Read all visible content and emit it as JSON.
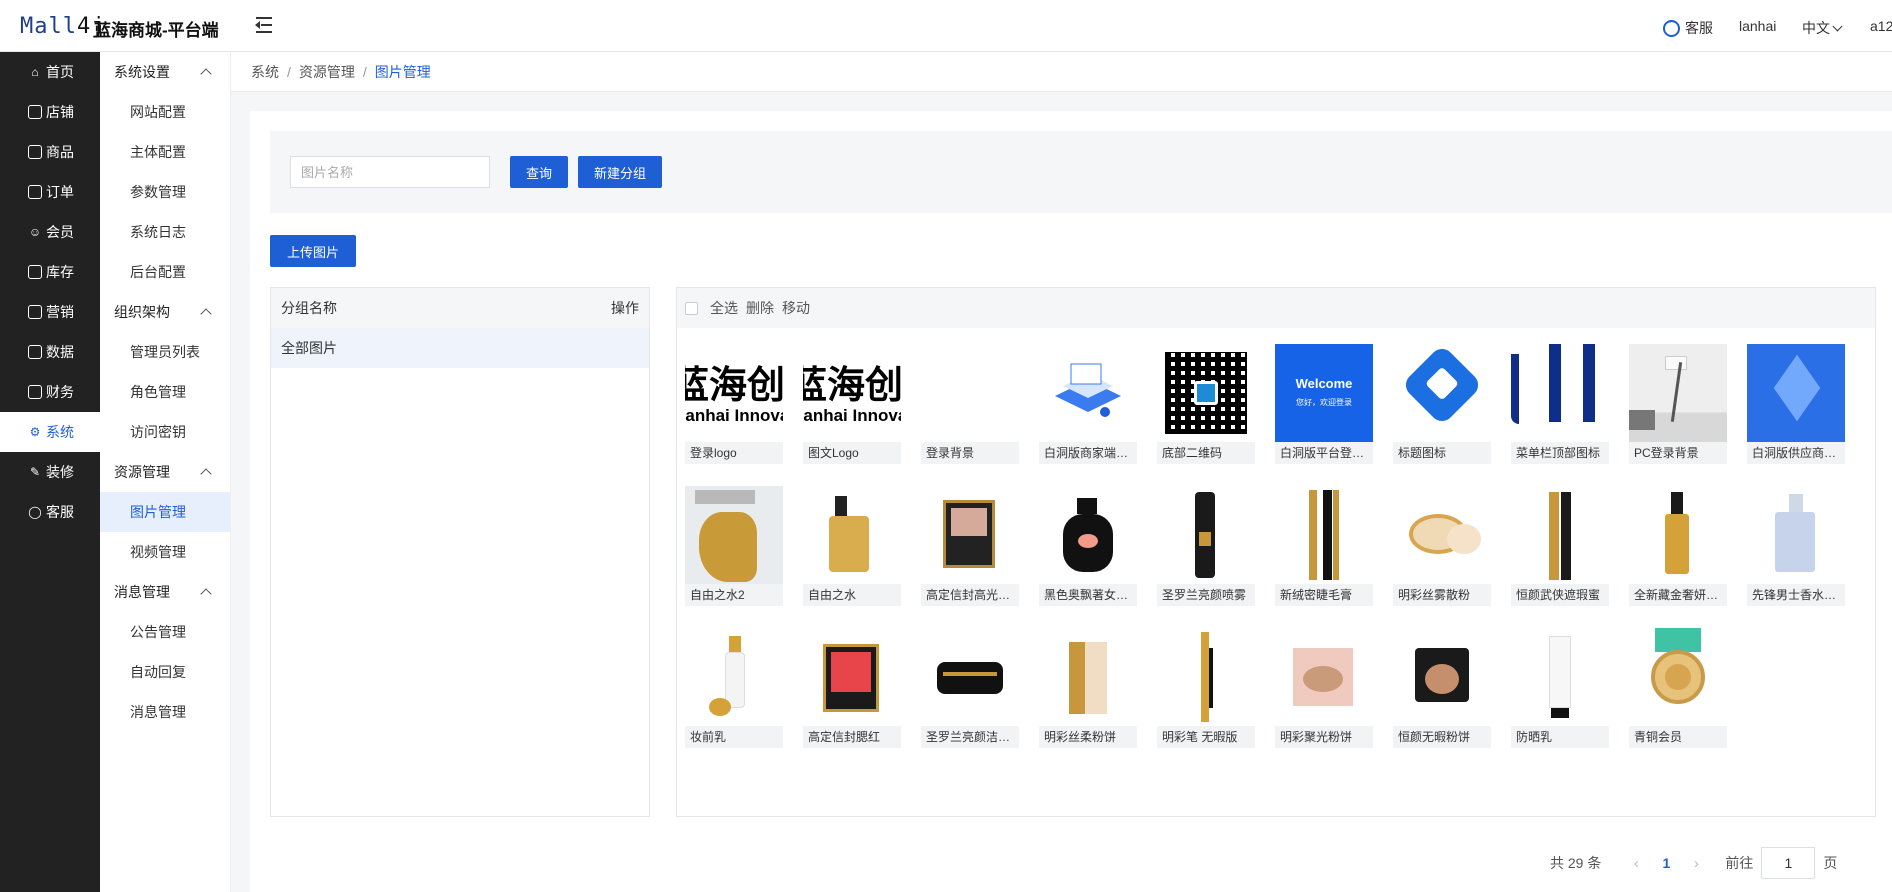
{
  "header": {
    "logo_text": "Mall4j",
    "app_title": "蓝海商城-平台端",
    "customer_service": "客服",
    "username": "lanhai",
    "language": "中文",
    "account": "a12"
  },
  "nav": {
    "items": [
      {
        "label": "首页",
        "icon": "home-icon"
      },
      {
        "label": "店铺",
        "icon": "shop-icon"
      },
      {
        "label": "商品",
        "icon": "goods-icon"
      },
      {
        "label": "订单",
        "icon": "order-icon"
      },
      {
        "label": "会员",
        "icon": "member-icon"
      },
      {
        "label": "库存",
        "icon": "stock-icon"
      },
      {
        "label": "营销",
        "icon": "gift-icon"
      },
      {
        "label": "数据",
        "icon": "data-icon"
      },
      {
        "label": "财务",
        "icon": "finance-icon"
      },
      {
        "label": "系统",
        "icon": "gear-icon"
      },
      {
        "label": "装修",
        "icon": "decorate-icon"
      },
      {
        "label": "客服",
        "icon": "chat-icon"
      }
    ],
    "active_index": 9
  },
  "submenu": {
    "groups": [
      {
        "title": "系统设置",
        "items": [
          "网站配置",
          "主体配置",
          "参数管理",
          "系统日志",
          "后台配置"
        ]
      },
      {
        "title": "组织架构",
        "items": [
          "管理员列表",
          "角色管理",
          "访问密钥"
        ]
      },
      {
        "title": "资源管理",
        "items": [
          "图片管理",
          "视频管理"
        ]
      },
      {
        "title": "消息管理",
        "items": [
          "公告管理",
          "自动回复",
          "消息管理"
        ]
      }
    ],
    "active_item": "图片管理"
  },
  "breadcrumb": [
    "系统",
    "资源管理",
    "图片管理"
  ],
  "search": {
    "placeholder": "图片名称",
    "value": "",
    "query_label": "查询",
    "new_group_label": "新建分组"
  },
  "upload_label": "上传图片",
  "groups_panel": {
    "col_name": "分组名称",
    "col_action": "操作",
    "rows": [
      "全部图片"
    ]
  },
  "image_toolbar": {
    "select_all": "全选",
    "delete": "删除",
    "move": "移动"
  },
  "images": [
    "登录logo",
    "图文Logo",
    "登录背景",
    "白洞版商家端…",
    "底部二维码",
    "白洞版平台登…",
    "标题图标",
    "菜单栏顶部图标",
    "PC登录背景",
    "白洞版供应商…",
    "自由之水2",
    "自由之水",
    "高定信封高光…",
    "黑色奥飘著女…",
    "圣罗兰亮颜喷雾",
    "新绒密睫毛膏",
    "明彩丝雾散粉",
    "恒颜武侠遮瑕蜜",
    "全新藏金奢妍…",
    "先锋男士香水…",
    "妆前乳",
    "高定信封腮红",
    "圣罗兰亮颜洁…",
    "明彩丝柔粉饼",
    "明彩笔 无暇版",
    "明彩聚光粉饼",
    "恒颜无暇粉饼",
    "防晒乳",
    "青铜会员"
  ],
  "thumb_text": {
    "logo_big": "蓝海创",
    "logo_small": "Lanhai Innovat",
    "welcome": "Welcome",
    "welcome_sub": "您好，欢迎登录"
  },
  "pagination": {
    "total": "共 29 条",
    "current_page": "1",
    "goto_prefix": "前往",
    "goto_value": "1",
    "goto_suffix": "页"
  },
  "colors": {
    "primary": "#1f5fd6",
    "nav_bg": "#222222",
    "active_bg": "#e8effc"
  }
}
